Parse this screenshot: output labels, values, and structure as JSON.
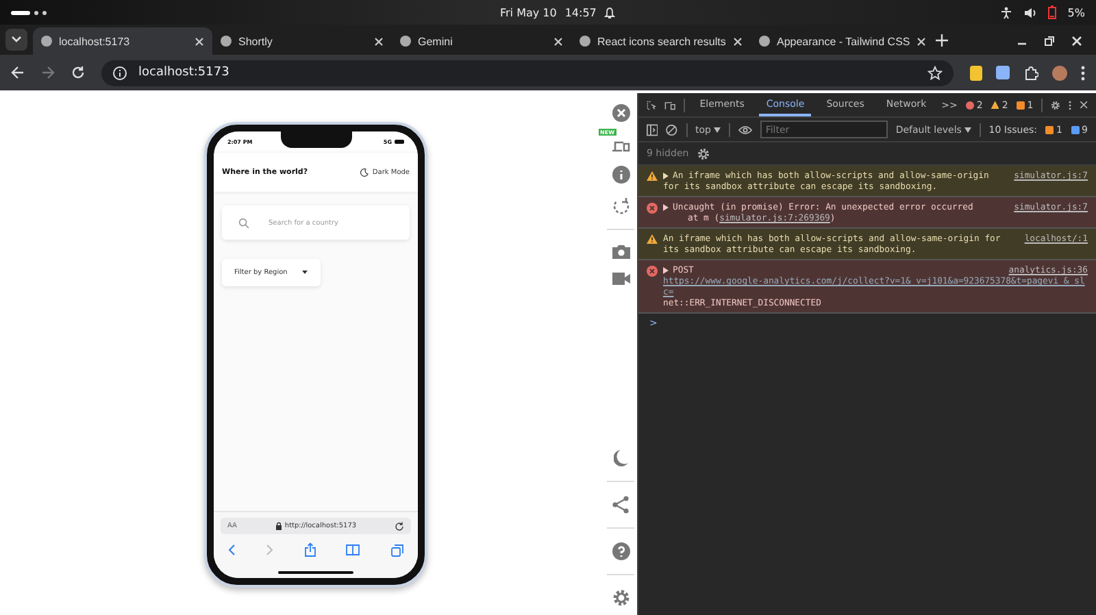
{
  "system_bar": {
    "date": "Fri May 10",
    "time": "14:57",
    "battery": "5%"
  },
  "tabs": [
    {
      "title": "localhost:5173",
      "selected": true
    },
    {
      "title": "Shortly",
      "selected": false
    },
    {
      "title": "Gemini",
      "selected": false
    },
    {
      "title": "React icons search results",
      "selected": false
    },
    {
      "title": "Appearance - Tailwind CSS",
      "selected": false
    }
  ],
  "address_bar": {
    "url": "localhost:5173"
  },
  "simulator": {
    "toolbar_badge": "NEW",
    "phone": {
      "status_time": "2:07 PM",
      "network": "5G",
      "header_title": "Where in the world?",
      "theme_toggle": "Dark Mode",
      "search": {
        "placeholder": "Search for a country"
      },
      "filter": {
        "label": "Filter by Region"
      },
      "safari_text_size": "AA",
      "safari_url": "http://localhost:5173"
    }
  },
  "devtools": {
    "tabs": [
      {
        "label": "Elements",
        "selected": false
      },
      {
        "label": "Console",
        "selected": true
      },
      {
        "label": "Sources",
        "selected": false
      },
      {
        "label": "Network",
        "selected": false
      }
    ],
    "more": ">>",
    "error_count": "2",
    "warning_count": "2",
    "issue_count": "1",
    "context": "top",
    "filter": {
      "placeholder": "Filter"
    },
    "levels": "Default levels",
    "issues_label": "10 Issues:",
    "issues_warnings": "1",
    "issues_info": "9",
    "hidden": "9 hidden",
    "messages": [
      {
        "kind": "warning",
        "expandable": true,
        "lines": [
          "An iframe which has both allow-scripts and allow-same-origin",
          "for its sandbox attribute can escape its sandboxing."
        ],
        "source": "simulator.js:7"
      },
      {
        "kind": "error",
        "expandable": true,
        "lines": [
          "Uncaught (in promise) Error: An unexpected error occurred"
        ],
        "detail_prefix": "at m (",
        "detail_link": "simulator.js:7:269369",
        "detail_suffix": ")",
        "source": "simulator.js:7"
      },
      {
        "kind": "warning",
        "expandable": false,
        "lines": [
          "An iframe which has both allow-scripts and allow-same-origin for",
          "its sandbox attribute can escape its sandboxing."
        ],
        "source": "localhost/:1"
      },
      {
        "kind": "error",
        "expandable": true,
        "lines": [
          "POST"
        ],
        "url": "https://www.google-analytics.com/j/collect?v=1&_v=j101&a=923675378&t=pagevi_&_slc=",
        "after": "net::ERR_INTERNET_DISCONNECTED",
        "source": "analytics.js:36"
      }
    ],
    "prompt": ">"
  }
}
